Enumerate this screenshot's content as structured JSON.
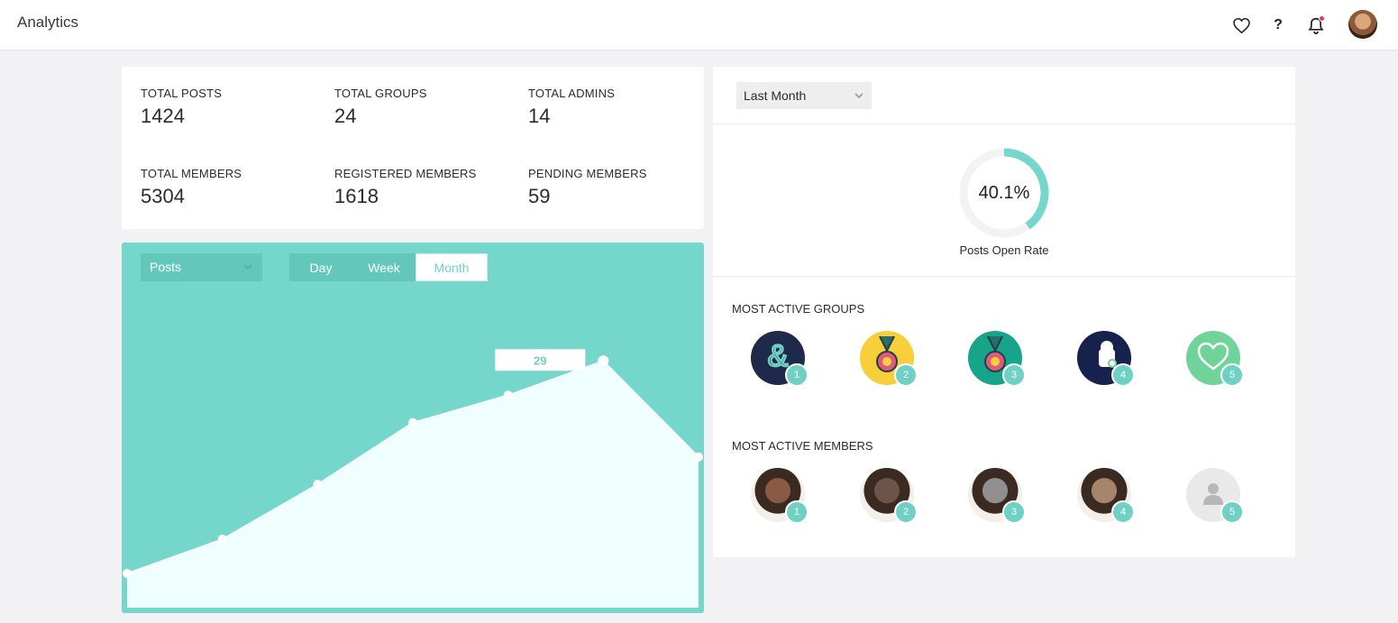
{
  "app": {
    "title": "Analytics"
  },
  "header_icons": [
    "heart-icon",
    "help-icon",
    "bell-icon"
  ],
  "header": {
    "help_glyph": "?"
  },
  "stats": [
    {
      "label": "TOTAL POSTS",
      "value": "1424"
    },
    {
      "label": "TOTAL GROUPS",
      "value": "24"
    },
    {
      "label": "TOTAL ADMINS",
      "value": "14"
    },
    {
      "label": "TOTAL MEMBERS",
      "value": "5304"
    },
    {
      "label": "REGISTERED MEMBERS",
      "value": "1618"
    },
    {
      "label": "PENDING MEMBERS",
      "value": "59"
    }
  ],
  "chart_controls": {
    "metric": "Posts",
    "periods": [
      "Day",
      "Week",
      "Month"
    ],
    "active_period": "Month"
  },
  "chart_data": {
    "type": "area",
    "title": "",
    "xlabel": "",
    "ylabel": "",
    "x": [
      1,
      2,
      3,
      4,
      5,
      6,
      7
    ],
    "series": [
      {
        "values": [
          5,
          10,
          18,
          27,
          31,
          36,
          22
        ]
      }
    ],
    "highlight": {
      "index": 5,
      "label": "29"
    },
    "ylim": [
      0,
      48
    ],
    "grid": false
  },
  "colors": {
    "accent": "#75d7cb",
    "accent_dark": "#63c8bb",
    "area_fill": "#effefe"
  },
  "right_panel": {
    "range": "Last Month",
    "open_rate": {
      "value": "40.1%",
      "fraction": 0.401,
      "label": "Posts Open Rate"
    },
    "groups_title": "MOST ACTIVE GROUPS",
    "groups": [
      {
        "rank": "1",
        "icon": "ampersand-icon",
        "bg": "#1f2a4a"
      },
      {
        "rank": "2",
        "icon": "medal-icon",
        "bg": "#f6cf3a"
      },
      {
        "rank": "3",
        "icon": "medal-icon",
        "bg": "#16a589"
      },
      {
        "rank": "4",
        "icon": "android-icon",
        "bg": "#18224e"
      },
      {
        "rank": "5",
        "icon": "handshake-heart-icon",
        "bg": "#6fd39a"
      }
    ],
    "members_title": "MOST ACTIVE MEMBERS",
    "members": [
      {
        "rank": "1",
        "tone": "#8b5a44"
      },
      {
        "rank": "2",
        "tone": "#6e5448"
      },
      {
        "rank": "3",
        "tone": "#8f8f8f"
      },
      {
        "rank": "4",
        "tone": "#a7856b"
      },
      {
        "rank": "5",
        "tone": "placeholder"
      }
    ]
  }
}
